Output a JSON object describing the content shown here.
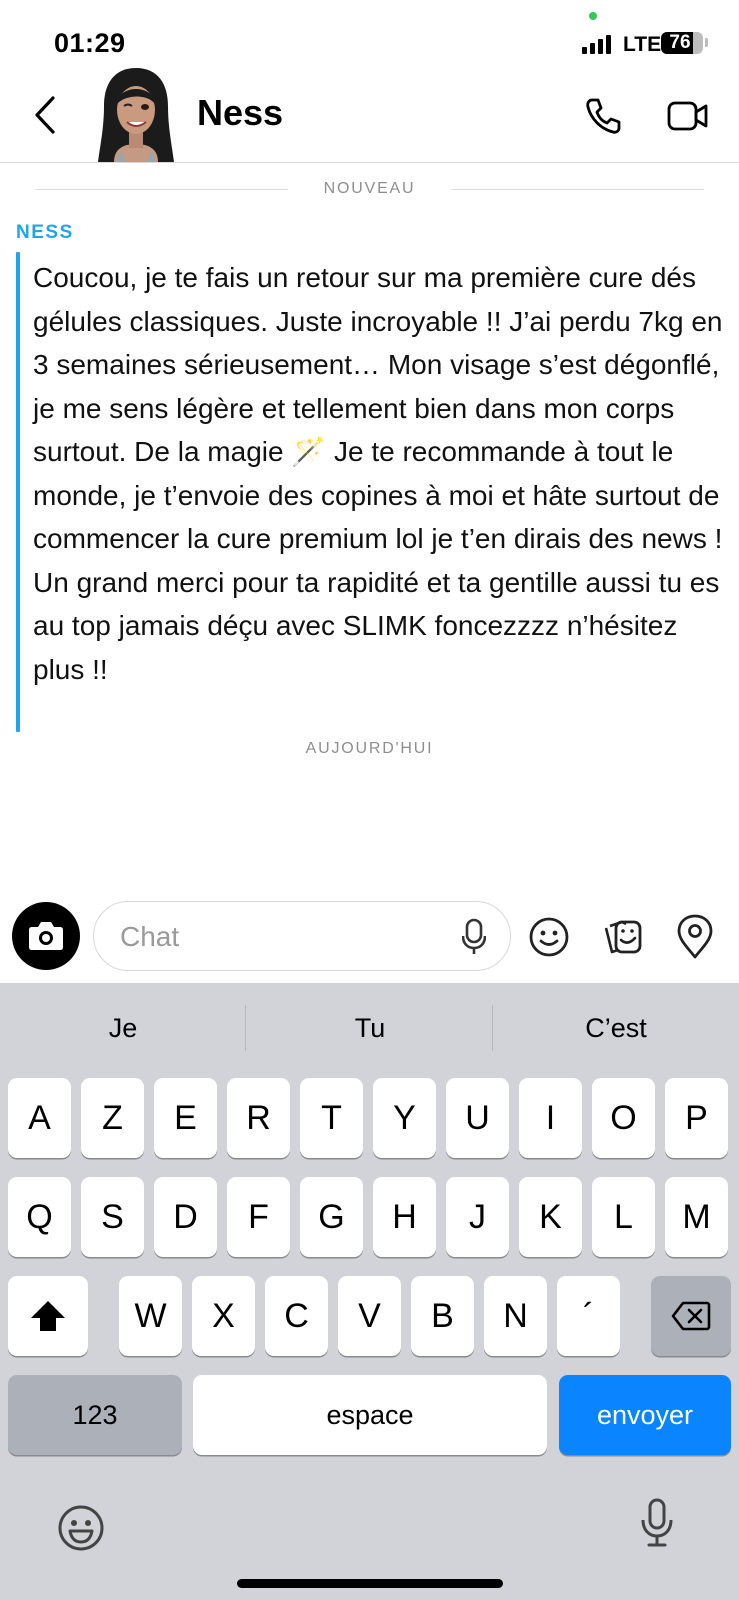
{
  "status_bar": {
    "time": "01:29",
    "network": "LTE",
    "battery": "76",
    "battery_level": 0.76,
    "signal_bars": 4
  },
  "header": {
    "contact_name": "Ness",
    "icons": [
      "back-chevron-icon",
      "bitmoji-avatar",
      "phone-icon",
      "video-camera-icon"
    ]
  },
  "chat": {
    "new_divider": "NOUVEAU",
    "sender": "NESS",
    "message": "Coucou, je te fais un retour sur ma première cure dés gélules classiques. Juste incroyable !! J’ai perdu 7kg en 3 semaines sérieusement… Mon visage s’est dégonflé, je me sens légère et tellement bien dans mon corps surtout. De la magie 🪄 Je te recommande à tout le monde, je t’envoie des copines à moi et hâte surtout de commencer la cure premium lol je t’en dirais des news ! Un grand merci pour ta rapidité et ta gentille aussi tu es au top jamais déçu avec SLIMK foncezzzz n’hésitez plus !!",
    "timestamp": "AUJOURD'HUI",
    "accent_color": "#1fa5e8"
  },
  "input_bar": {
    "placeholder": "Chat",
    "icons": [
      "camera-icon",
      "microphone-icon",
      "emoji-icon",
      "sticker-icon",
      "location-pin-icon"
    ]
  },
  "keyboard": {
    "suggestions": [
      "Je",
      "Tu",
      "C’est"
    ],
    "row1": [
      "A",
      "Z",
      "E",
      "R",
      "T",
      "Y",
      "U",
      "I",
      "O",
      "P"
    ],
    "row2": [
      "Q",
      "S",
      "D",
      "F",
      "G",
      "H",
      "J",
      "K",
      "L",
      "M"
    ],
    "row3": [
      "W",
      "X",
      "C",
      "V",
      "B",
      "N",
      "´"
    ],
    "numbers_key": "123",
    "space_key": "espace",
    "send_key": "envoyer",
    "send_color": "#0a84ff"
  }
}
